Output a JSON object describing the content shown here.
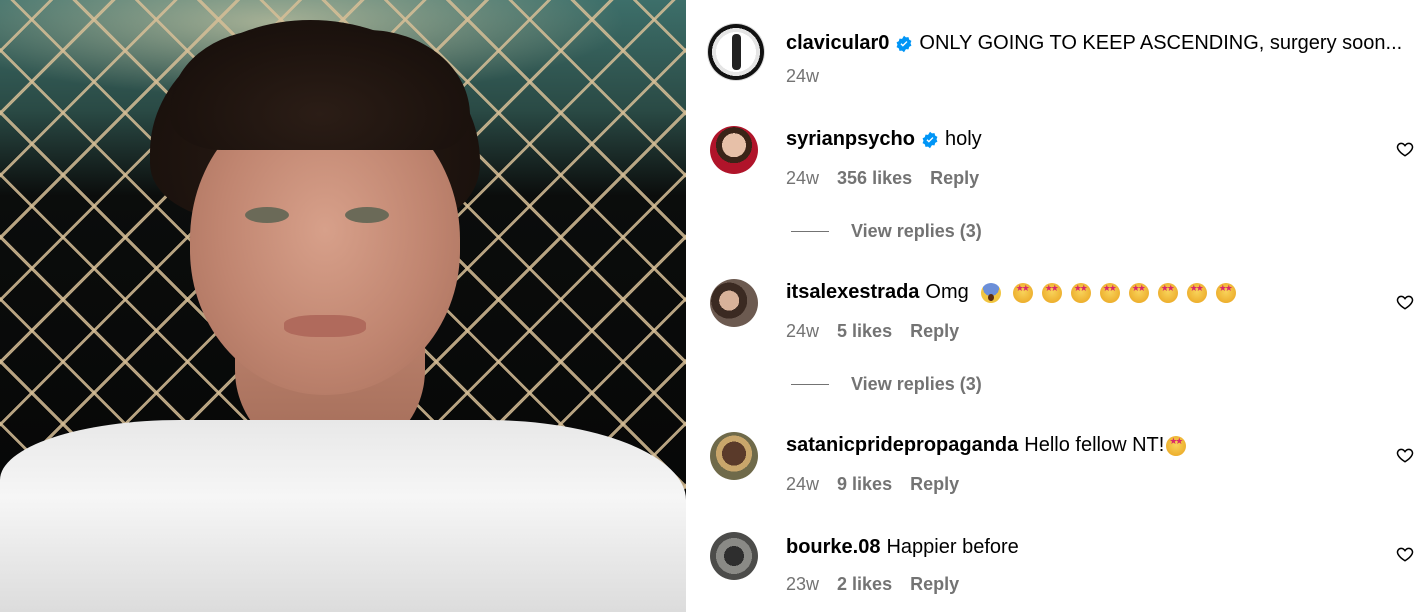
{
  "post": {
    "username": "clavicular0",
    "verified": true,
    "caption": "ONLY GOING TO KEEP ASCENDING, surgery soon...",
    "time": "24w"
  },
  "comments": [
    {
      "username": "syrianpsycho",
      "verified": true,
      "text": "holy",
      "time": "24w",
      "likes": "356 likes",
      "reply": "Reply",
      "view_replies": "View replies (3)"
    },
    {
      "username": "itsalexestrada",
      "verified": false,
      "text": "Omg",
      "emojis": [
        "face-screaming-emoji",
        "star-struck-emoji",
        "star-struck-emoji",
        "star-struck-emoji",
        "star-struck-emoji",
        "star-struck-emoji",
        "star-struck-emoji",
        "star-struck-emoji",
        "star-struck-emoji"
      ],
      "time": "24w",
      "likes": "5 likes",
      "reply": "Reply",
      "view_replies": "View replies (3)"
    },
    {
      "username": "satanicpridepropaganda",
      "verified": false,
      "text": "Hello fellow NT!",
      "emojis": [
        "star-struck-emoji"
      ],
      "time": "24w",
      "likes": "9 likes",
      "reply": "Reply"
    },
    {
      "username": "bourke.08",
      "verified": false,
      "text": "Happier before",
      "time": "23w",
      "likes": "2 likes",
      "reply": "Reply"
    }
  ],
  "icons": {
    "like": "heart-outline-icon",
    "verified": "verified-badge-icon"
  },
  "colors": {
    "verified_blue": "#0095f6",
    "secondary_text": "#737373"
  }
}
